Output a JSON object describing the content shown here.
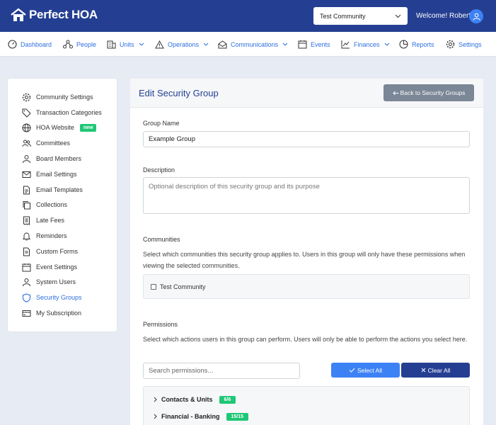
{
  "app": {
    "brand": "Perfect HOA"
  },
  "header": {
    "community": "Test Community",
    "welcome": "Welcome! Robert"
  },
  "nav": [
    {
      "label": "Dashboard"
    },
    {
      "label": "People"
    },
    {
      "label": "Units"
    },
    {
      "label": "Operations"
    },
    {
      "label": "Communications"
    },
    {
      "label": "Events"
    },
    {
      "label": "Finances"
    },
    {
      "label": "Reports"
    },
    {
      "label": "Settings"
    }
  ],
  "sidebar": {
    "items": [
      {
        "label": "Community Settings"
      },
      {
        "label": "Transaction Categories"
      },
      {
        "label": "HOA Website",
        "badge": "new"
      },
      {
        "label": "Committees"
      },
      {
        "label": "Board Members"
      },
      {
        "label": "Email Settings"
      },
      {
        "label": "Email Templates"
      },
      {
        "label": "Collections"
      },
      {
        "label": "Late Fees"
      },
      {
        "label": "Reminders"
      },
      {
        "label": "Custom Forms"
      },
      {
        "label": "Event Settings"
      },
      {
        "label": "System Users"
      },
      {
        "label": "Security Groups"
      },
      {
        "label": "My Subscription"
      }
    ]
  },
  "form": {
    "title": "Edit Security Group",
    "back_label": "Back to Security Groups",
    "group_name_label": "Group Name",
    "group_name_value": "Example Group",
    "description_label": "Description",
    "description_placeholder": "Optional description of this security group and its purpose",
    "communities_label": "Communities",
    "communities_help": "Select which communities this security group applies to. Users in this group will only have these permissions when viewing the selected communities.",
    "community_option": "Test Community",
    "permissions_label": "Permissions",
    "permissions_help": "Select which actions users in this group can perform. Users will only be able to perform the actions you select here.",
    "search_placeholder": "Search permissions...",
    "select_all": "Select All",
    "clear_all": "Clear All",
    "groups": [
      {
        "label": "Contacts & Units",
        "count": "6/6"
      },
      {
        "label": "Financial - Banking",
        "count": "15/15"
      }
    ]
  }
}
